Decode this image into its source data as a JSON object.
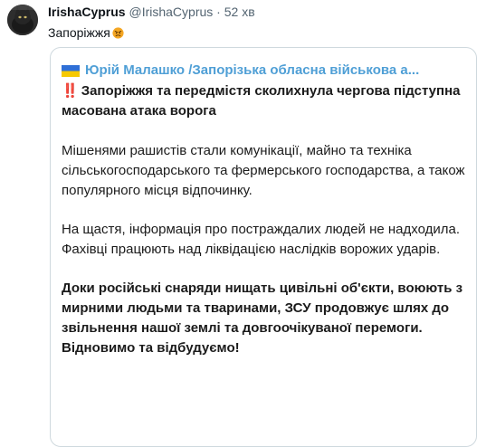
{
  "tweet": {
    "author_name": "IrishaCyprus",
    "author_handle": "@IrishaCyprus",
    "separator": "·",
    "time": "52 хв",
    "text": "Запоріжжя",
    "emoji": "angry-face-emoji"
  },
  "card": {
    "flag_icon": "ukraine-flag-icon",
    "title": "Юрій Малашко /Запорізька обласна військова а...",
    "alert_icon": "‼️",
    "headline": "Запоріжжя та передмістя сколихнула чергова підступна масована атака ворога",
    "paragraph_1": "Мішенями рашистів стали комунікації, майно та техніка сільськогосподарського та фермерського господарства, а також популярного місця відпочинку.",
    "paragraph_2_line_1": "На щастя, інформація про постраждалих людей не надходила.",
    "paragraph_2_line_2": "Фахівці працюють над ліквідацією наслідків ворожих ударів.",
    "paragraph_3": "Доки російські снаряди нищать цивільні об'єкти, воюють з мирними людьми та тваринами, ЗСУ продовжує шлях до звільнення нашої землі та довгоочікуваної перемоги.",
    "paragraph_3_end": "Відновимо та відбудуємо!"
  },
  "colors": {
    "link_blue": "#4f9fd6",
    "muted_gray": "#536471",
    "border": "#cfd9de",
    "alert_red": "#e0202a"
  }
}
